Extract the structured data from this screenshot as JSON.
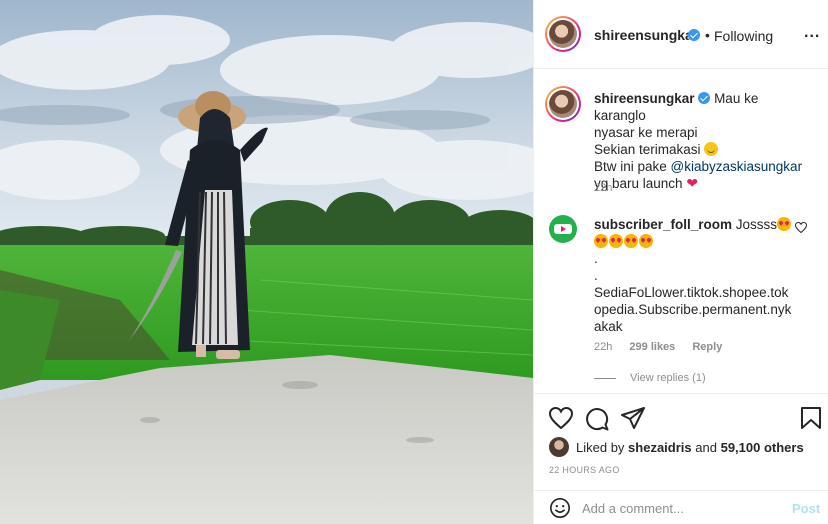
{
  "post": {
    "author": "shireensungkar",
    "follow_dot": "•",
    "follow_label": "Following",
    "more_icon": "...",
    "photo_description_icon": "photo"
  },
  "caption": {
    "author": "shireensungkar",
    "line1": " Mau ke karanglo",
    "line2": "nyasar ke merapi",
    "line3": "Sekian terimakasi ",
    "line4_prefix": "Btw ini pake ",
    "line4_mention": "@kiabyzaskiasungkar",
    "line5": "yg baru launch ",
    "time": "22h"
  },
  "comment": {
    "author": "subscriber_foll_room",
    "text_start": " Jossss",
    "text_body": ".\n.\nSediaFoLlower.tiktok.shopee.tokopedia.Subscribe.permanent.nykakak",
    "time": "22h",
    "likes": "299 likes",
    "reply": "Reply",
    "view_replies": "View replies (1)"
  },
  "actions": {
    "liked_by_prefix": "Liked by ",
    "liked_by_user": "shezaidris",
    "liked_by_mid": " and ",
    "liked_by_count": "59,100 others",
    "post_time": "22 HOURS AGO",
    "comment_placeholder": "Add a comment...",
    "post_button": "Post"
  },
  "colors": {
    "accent": "#3897f0",
    "link": "#00376b",
    "heart": "#e0245e",
    "muted": "#8e8e8e"
  }
}
